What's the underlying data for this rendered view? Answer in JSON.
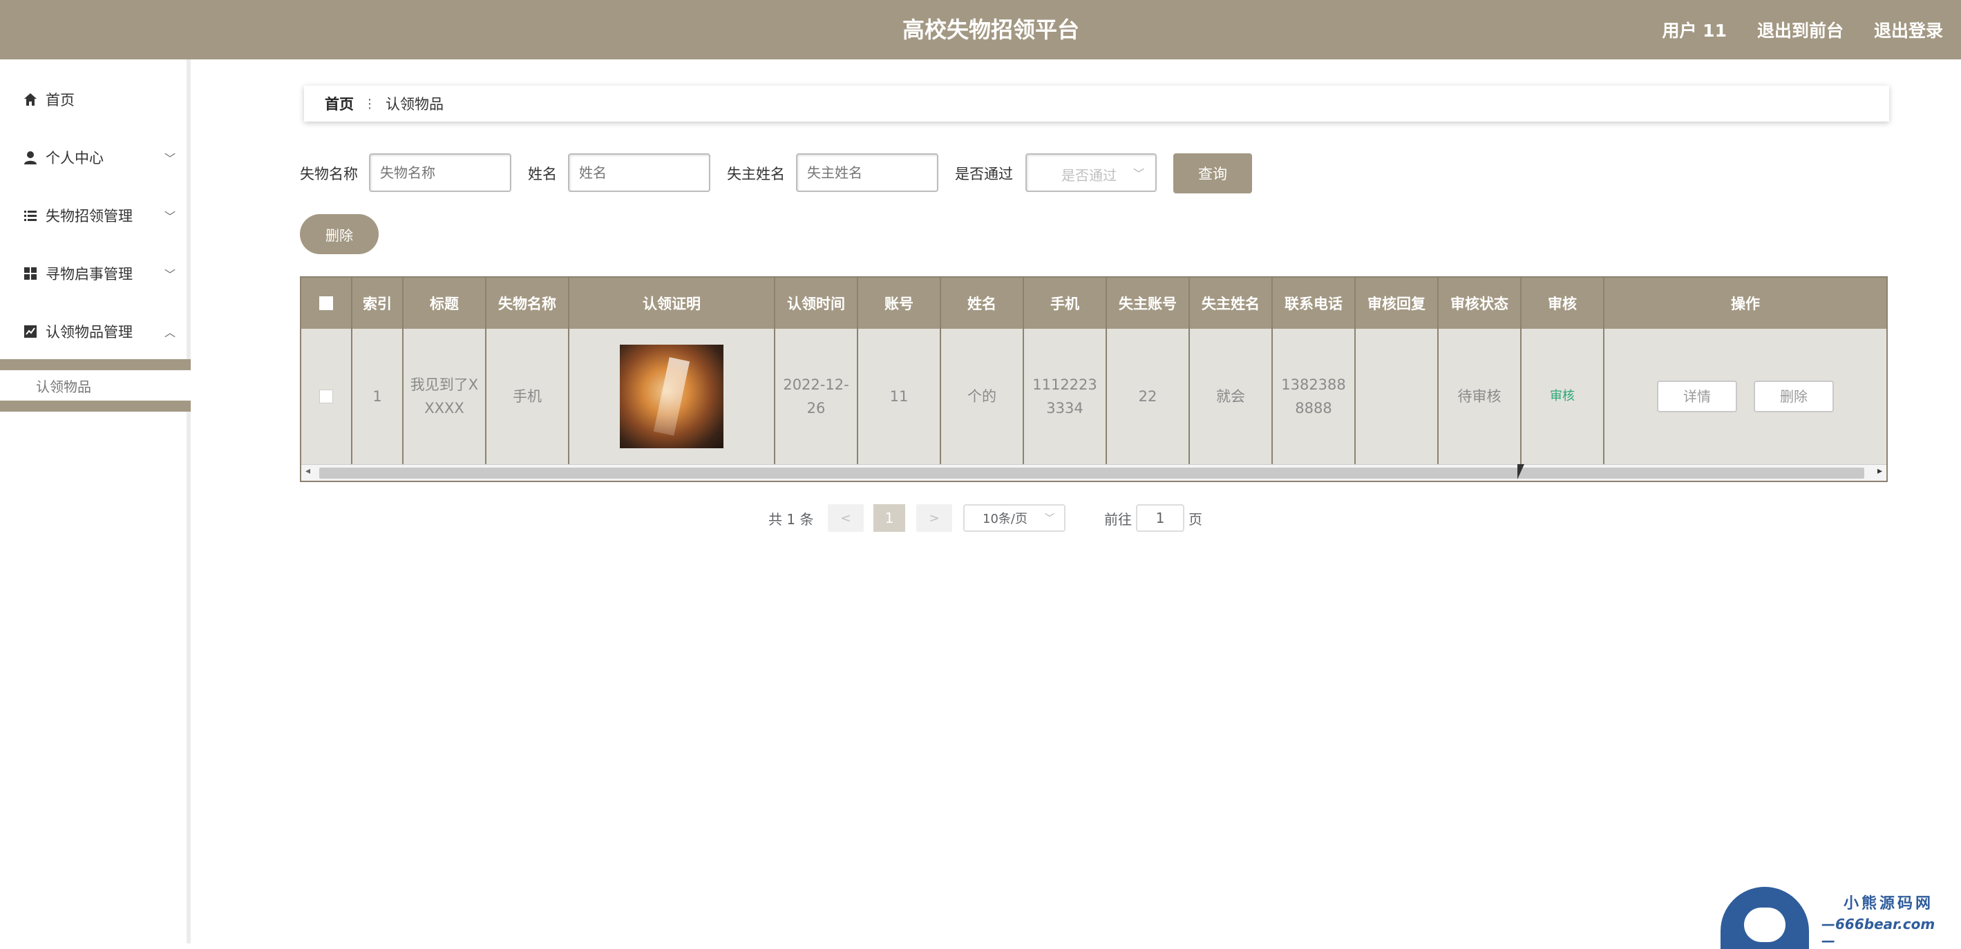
{
  "header": {
    "title": "高校失物招领平台",
    "user": "用户 11",
    "back_front": "退出到前台",
    "logout": "退出登录"
  },
  "sidebar": {
    "items": [
      {
        "label": "首页",
        "icon": "home-icon"
      },
      {
        "label": "个人中心",
        "icon": "user-icon"
      },
      {
        "label": "失物招领管理",
        "icon": "list-icon"
      },
      {
        "label": "寻物启事管理",
        "icon": "grid-icon"
      },
      {
        "label": "认领物品管理",
        "icon": "chart-icon"
      }
    ],
    "sub_items": [
      {
        "label": "认领物品"
      }
    ]
  },
  "breadcrumb": {
    "home": "首页",
    "separator": "⋮",
    "current": "认领物品"
  },
  "search": {
    "item_name_label": "失物名称",
    "item_name_placeholder": "失物名称",
    "name_label": "姓名",
    "name_placeholder": "姓名",
    "owner_name_label": "失主姓名",
    "owner_name_placeholder": "失主姓名",
    "passed_label": "是否通过",
    "passed_placeholder": "是否通过",
    "query_button": "查询",
    "delete_button": "删除"
  },
  "table": {
    "headers": [
      "索引",
      "标题",
      "失物名称",
      "认领证明",
      "认领时间",
      "账号",
      "姓名",
      "手机",
      "失主账号",
      "失主姓名",
      "联系电话",
      "审核回复",
      "审核状态",
      "审核",
      "操作"
    ],
    "rows": [
      {
        "index": "1",
        "title": "我见到了XXXXX",
        "item_name": "手机",
        "claim_time": "2022-12-26",
        "account": "11",
        "name": "个的",
        "phone": "11122233334",
        "owner_account": "22",
        "owner_name": "就会",
        "contact_phone": "13823888888",
        "audit_reply": "",
        "audit_status": "待审核",
        "audit_action": "审核",
        "detail_button": "详情",
        "delete_button": "删除"
      }
    ]
  },
  "pagination": {
    "total": "共 1 条",
    "prev": "<",
    "current": "1",
    "next": ">",
    "page_size": "10条/页",
    "goto_label": "前往",
    "goto_value": "1",
    "page_suffix": "页"
  },
  "watermark": {
    "title": "小熊源码网",
    "url": "—666bear.com—"
  },
  "colors": {
    "accent": "#a39883",
    "audit_link": "#2aa876"
  }
}
